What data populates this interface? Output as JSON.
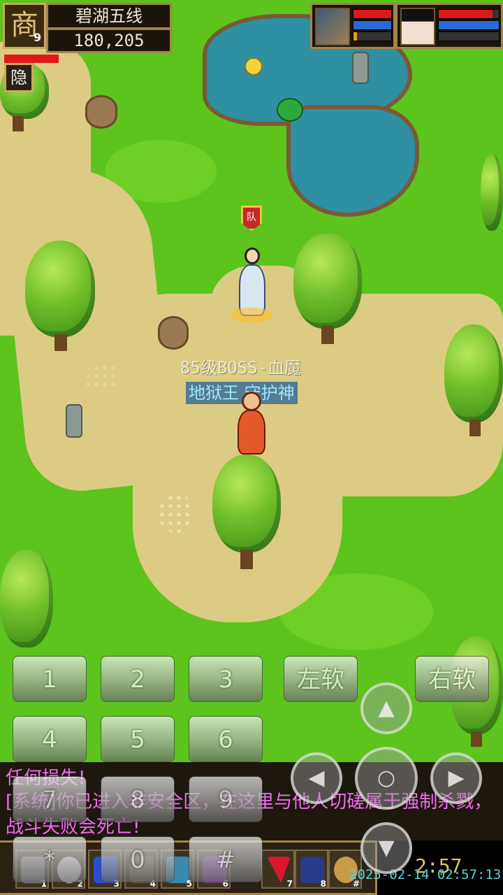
{
  "location": {
    "portrait_glyph": "商",
    "level": "9",
    "map_name": "碧湖五线",
    "coords": "180,205"
  },
  "hud": {
    "hide_label": "隐",
    "party": [
      {
        "name": "companion-1",
        "hp": 1.0,
        "mp": 1.0,
        "exp": 0.1
      },
      {
        "name": "companion-2",
        "hp": 0.9,
        "mp": 1.0,
        "exp": 0.0
      }
    ]
  },
  "world": {
    "boss_title": "85级BOSS-血魔",
    "boss_subtitle": "地狱王 守护神",
    "player_flag": "队"
  },
  "keypad": {
    "keys": [
      "1",
      "2",
      "3",
      "4",
      "5",
      "6",
      "7",
      "8",
      "9",
      "*",
      "0",
      "#"
    ],
    "left_soft": "左软",
    "right_soft": "右软",
    "dpad": {
      "up": "▲",
      "left": "◀",
      "right": "▶",
      "down": "▼",
      "center": "○"
    }
  },
  "chat": {
    "lines": [
      "任何损失!",
      "[系统]你已进入非安全区，在这里与他人切磋属于强制杀戮，",
      "战斗失败会死亡!"
    ]
  },
  "skillbar": {
    "slots": [
      {
        "num": "1",
        "icon": "gear-icon"
      },
      {
        "num": "2",
        "icon": "chat-bubble-icon"
      },
      {
        "num": "3",
        "icon": "potion-icon"
      },
      {
        "num": "4",
        "icon": "boot-icon"
      },
      {
        "num": "5",
        "icon": "card-icon"
      },
      {
        "num": "6",
        "icon": "beast-icon"
      },
      {
        "num": "7",
        "icon": "red-flag-icon"
      },
      {
        "num": "8",
        "icon": "team-icon"
      },
      {
        "num": "#",
        "icon": "horn-icon"
      }
    ],
    "timer": "2:57",
    "timestamp": "2025-02-14 02:57:13"
  },
  "colors": {
    "grass": "#5cc41c",
    "path": "#dccb82",
    "water": "#2f8fa3",
    "chat_text": "#f06cf0",
    "frame_gold": "#a3844c"
  }
}
